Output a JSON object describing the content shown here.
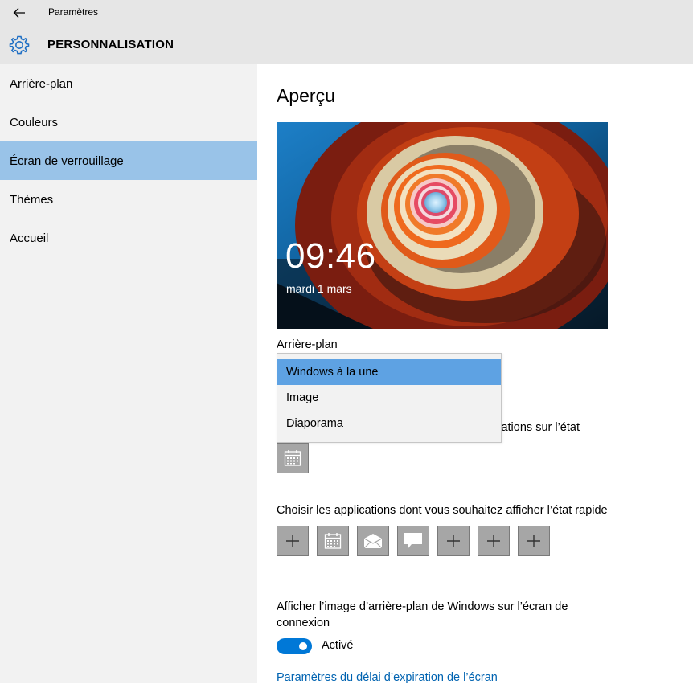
{
  "header": {
    "app_title": "Paramètres",
    "section_title": "PERSONNALISATION",
    "back_icon": "arrow-left-icon",
    "section_icon": "gear-icon"
  },
  "sidebar": {
    "items": [
      {
        "label": "Arrière-plan",
        "selected": false
      },
      {
        "label": "Couleurs",
        "selected": false
      },
      {
        "label": "Écran de verrouillage",
        "selected": true
      },
      {
        "label": "Thèmes",
        "selected": false
      },
      {
        "label": "Accueil",
        "selected": false
      }
    ]
  },
  "main": {
    "preview_heading": "Aperçu",
    "preview": {
      "time": "09:46",
      "date": "mardi 1 mars"
    },
    "background_label": "Arrière-plan",
    "background_dropdown": {
      "options": [
        "Windows à la une",
        "Image",
        "Diaporama"
      ],
      "selected": "Windows à la une"
    },
    "detailed_status_label_visible_part": "ations sur l’état",
    "detailed_status_app_icon": "calendar-icon",
    "quick_status_label": "Choisir les applications dont vous souhaitez afficher l’état rapide",
    "quick_status_apps": [
      "plus-icon",
      "calendar-icon",
      "mail-icon",
      "message-icon",
      "plus-icon",
      "plus-icon",
      "plus-icon"
    ],
    "signin_bg_label": "Afficher l’image d’arrière-plan de Windows sur l’écran de connexion",
    "signin_bg_toggle": {
      "state": "Activé",
      "on": true
    },
    "timeout_link": "Paramètres du délai d’expiration de l’écran"
  },
  "colors": {
    "selected_nav": "#99c3e8",
    "selected_option": "#5ea2e3",
    "toggle_on": "#0078d7",
    "link": "#0063b1"
  }
}
